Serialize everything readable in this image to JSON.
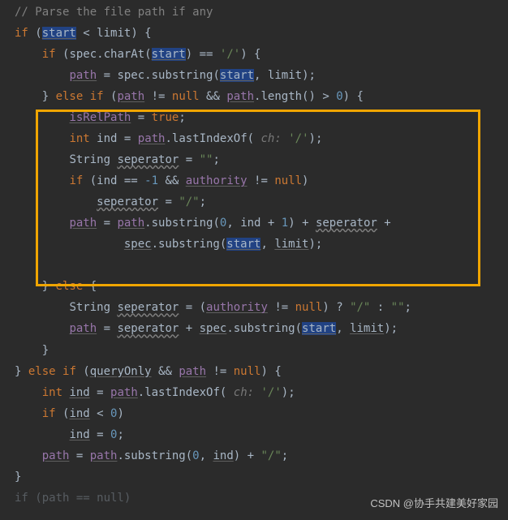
{
  "code": {
    "c1": "// Parse the file path if any",
    "k_if": "if",
    "k_else": "else",
    "k_true": "true",
    "k_null": "null",
    "k_int": "int",
    "k_String": "String",
    "v_start": "start",
    "v_limit": "limit",
    "v_spec": "spec",
    "v_path": "path",
    "v_isRelPath": "isRelPath",
    "v_ind": "ind",
    "v_seperator": "seperator",
    "v_authority": "authority",
    "v_queryOnly": "queryOnly",
    "m_charAt": ".charAt(",
    "m_substring": ".substring(",
    "m_length": ".length()",
    "m_lastIndexOf": ".lastIndexOf(",
    "s_slash_char": "'/'",
    "s_slash_str": "\"/\"",
    "s_empty": "\"\"",
    "n_0": "0",
    "n_1": "1",
    "n_neg1": "-1",
    "hint_ch": " ch: ",
    "op_lt": " < ",
    "op_eq": " == ",
    "op_ne": " != ",
    "op_and": " && ",
    "op_gt": " > ",
    "op_assign": " = ",
    "op_plus": " + ",
    "op_tern_q": " ? ",
    "op_tern_c": " : ",
    "paren_cb": ") {",
    "brace_c_else": "} ",
    "brace_c": "}",
    "paren_o": " (",
    "comma": ", ",
    "paren_close": ")",
    "semi": ";",
    "paren_close_semi": ");",
    "plus_cont": " +",
    "frag_last": "if (path == null)"
  },
  "watermark": "CSDN @协手共建美好家园"
}
